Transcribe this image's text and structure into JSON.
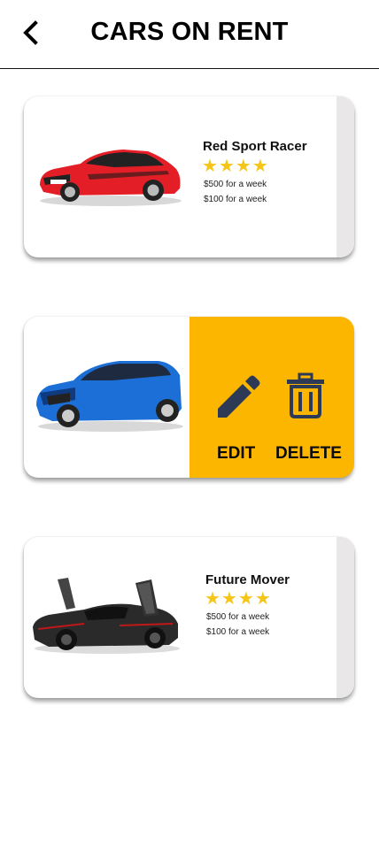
{
  "header": {
    "title": "CARS ON RENT"
  },
  "cars": [
    {
      "name": "Red Sport Racer",
      "rating": 4,
      "price_week": "$500 for a week",
      "price_day": "$100 for a week"
    },
    {
      "name": "",
      "rating": null,
      "price_week": "",
      "price_day": ""
    },
    {
      "name": "Future Mover",
      "rating": 4,
      "price_week": "$500 for a week",
      "price_day": "$100 for a week"
    }
  ],
  "actions": {
    "edit_label": "EDIT",
    "delete_label": "DELETE"
  },
  "colors": {
    "action_bg": "#fdb600",
    "star": "#f5c518",
    "strip": "#e9e7e8",
    "icon": "#2d3a55"
  },
  "icons": {
    "back": "chevron-left-icon",
    "edit": "pencil-icon",
    "delete": "trash-icon",
    "rating": "star-icon"
  }
}
